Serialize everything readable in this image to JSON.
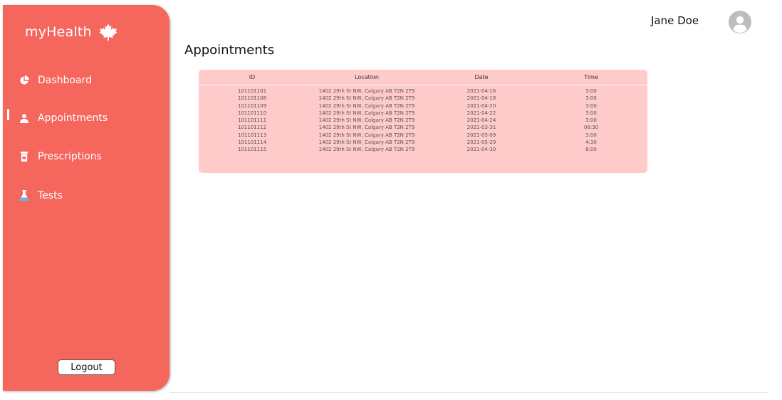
{
  "app": {
    "name": "myHealth"
  },
  "sidebar": {
    "items": [
      {
        "label": "Dashboard",
        "icon": "pie-chart-icon"
      },
      {
        "label": "Appointments",
        "icon": "user-icon"
      },
      {
        "label": "Prescriptions",
        "icon": "pill-bottle-icon"
      },
      {
        "label": "Tests",
        "icon": "flask-icon"
      }
    ],
    "active_index": 1,
    "logout_label": "Logout"
  },
  "header": {
    "user_name": "Jane Doe"
  },
  "main": {
    "title": "Appointments",
    "table": {
      "columns": [
        "ID",
        "Location",
        "Date",
        "Time"
      ],
      "rows": [
        [
          "101101101",
          "1402 29th St NW, Calgary AB T2N 2T9",
          "2021-04-16",
          "3:00"
        ],
        [
          "101101108",
          "1402 29th St NW, Calgary AB T2N 2T9",
          "2021-04-18",
          "3:00"
        ],
        [
          "101101109",
          "1402 29th St NW, Calgary AB T2N 2T9",
          "2021-04-20",
          "3:00"
        ],
        [
          "101101110",
          "1402 29th St NW, Calgary AB T2N 2T9",
          "2021-04-22",
          "3:00"
        ],
        [
          "101101111",
          "1402 29th St NW, Calgary AB T2N 2T9",
          "2021-04-24",
          "3:00"
        ],
        [
          "101101112",
          "1402 29th St NW, Calgary AB T2N 2T9",
          "2021-03-31",
          "08:30"
        ],
        [
          "101101113",
          "1402 29th St NW, Calgary AB T2N 2T9",
          "2021-05-09",
          "3:00"
        ],
        [
          "101101114",
          "1402 29th St NW, Calgary AB T2N 2T9",
          "2021-05-29",
          "4:30"
        ],
        [
          "101101115",
          "1402 29th St NW, Calgary AB T2N 2T9",
          "2021-04-30",
          "8:00"
        ]
      ]
    }
  },
  "colors": {
    "sidebar": "#f5665d",
    "table_bg": "#ffcaca",
    "avatar": "#bdbdbd"
  }
}
